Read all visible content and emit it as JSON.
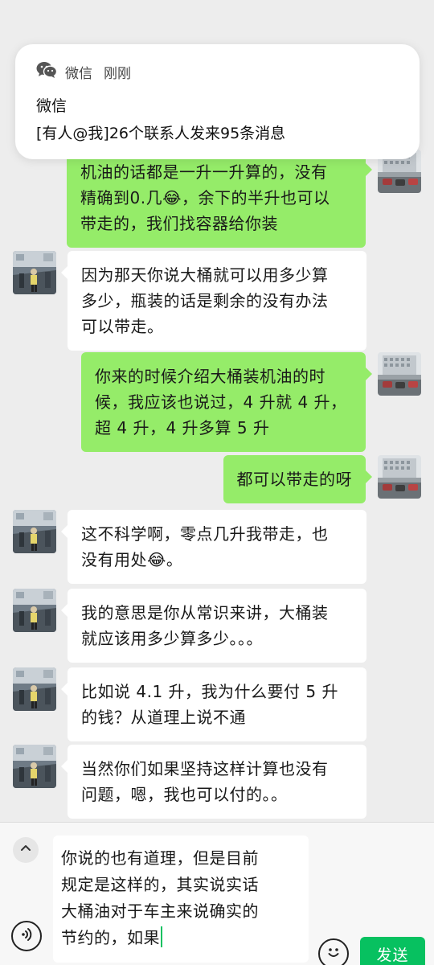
{
  "notification": {
    "app_name": "微信",
    "time": "刚刚",
    "title": "微信",
    "body": "[有人@我]26个联系人发来95条消息"
  },
  "messages": [
    {
      "side": "out",
      "text": "机油的话都是一升一升算的，没有\n精确到0.几😂，余下的半升也可以\n带走的，我们找容器给你装"
    },
    {
      "side": "in",
      "text": "因为那天你说大桶就可以用多少算\n多少，瓶装的话是剩余的没有办法\n可以带走。"
    },
    {
      "side": "out",
      "text": "你来的时候介绍大桶装机油的时\n候，我应该也说过，4 升就 4 升，\n超 4 升，4 升多算 5 升"
    },
    {
      "side": "out",
      "text": "都可以带走的呀"
    },
    {
      "side": "in",
      "text": "这不科学啊，零点几升我带走，也\n没有用处😂。"
    },
    {
      "side": "in",
      "text": "我的意思是你从常识来讲，大桶装\n就应该用多少算多少。。。"
    },
    {
      "side": "in",
      "text": "比如说 4.1 升，我为什么要付 5 升\n的钱？从道理上说不通"
    },
    {
      "side": "in",
      "text": "当然你们如果坚持这样计算也没有\n问题，嗯，我也可以付的。。"
    }
  ],
  "input": {
    "value": "你说的也有道理，但是目前\n规定是这样的，其实说实话\n大桶油对于车主来说确实的\n节约的，如果"
  },
  "buttons": {
    "send": "发送"
  },
  "icons": {
    "collapse": "chevron-up-icon",
    "voice": "voice-icon",
    "emoji": "emoji-icon",
    "notification_app": "wechat-icon"
  },
  "colors": {
    "outgoing_bubble": "#95ec69",
    "incoming_bubble": "#ffffff",
    "send_button": "#07c160",
    "background": "#ededed"
  }
}
